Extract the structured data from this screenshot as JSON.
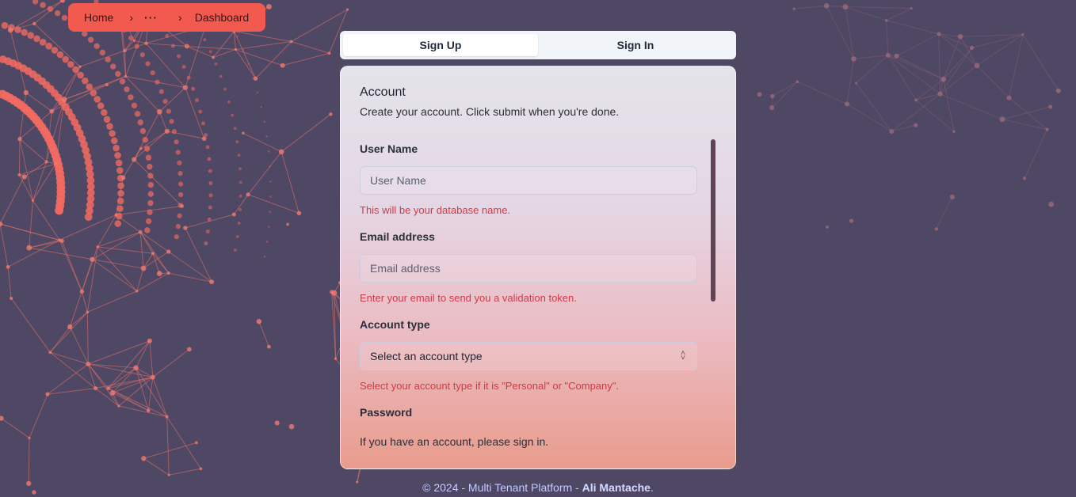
{
  "breadcrumb": {
    "home": "Home",
    "ellipsis": "···",
    "current": "Dashboard"
  },
  "tabs": {
    "signup": "Sign Up",
    "signin": "Sign In",
    "active": "signup"
  },
  "card": {
    "title": "Account",
    "description": "Create your account. Click submit when you're done.",
    "fields": {
      "username": {
        "label": "User Name",
        "placeholder": "User Name",
        "hint": "This will be your database name."
      },
      "email": {
        "label": "Email address",
        "placeholder": "Email address",
        "hint": "Enter your email to send you a validation token."
      },
      "account_type": {
        "label": "Account type",
        "value": "Select an account type",
        "hint": "Select your account type if it is \"Personal\" or \"Company\"."
      },
      "password": {
        "label": "Password"
      }
    },
    "signin_note": "If you have an account, please sign in."
  },
  "footer": {
    "text": "© 2024 - Multi Tenant Platform - ",
    "author": "Ali Mantache",
    "end": "."
  },
  "colors": {
    "background": "#4f4864",
    "accent": "#f25a50",
    "hint": "#d03a48"
  }
}
